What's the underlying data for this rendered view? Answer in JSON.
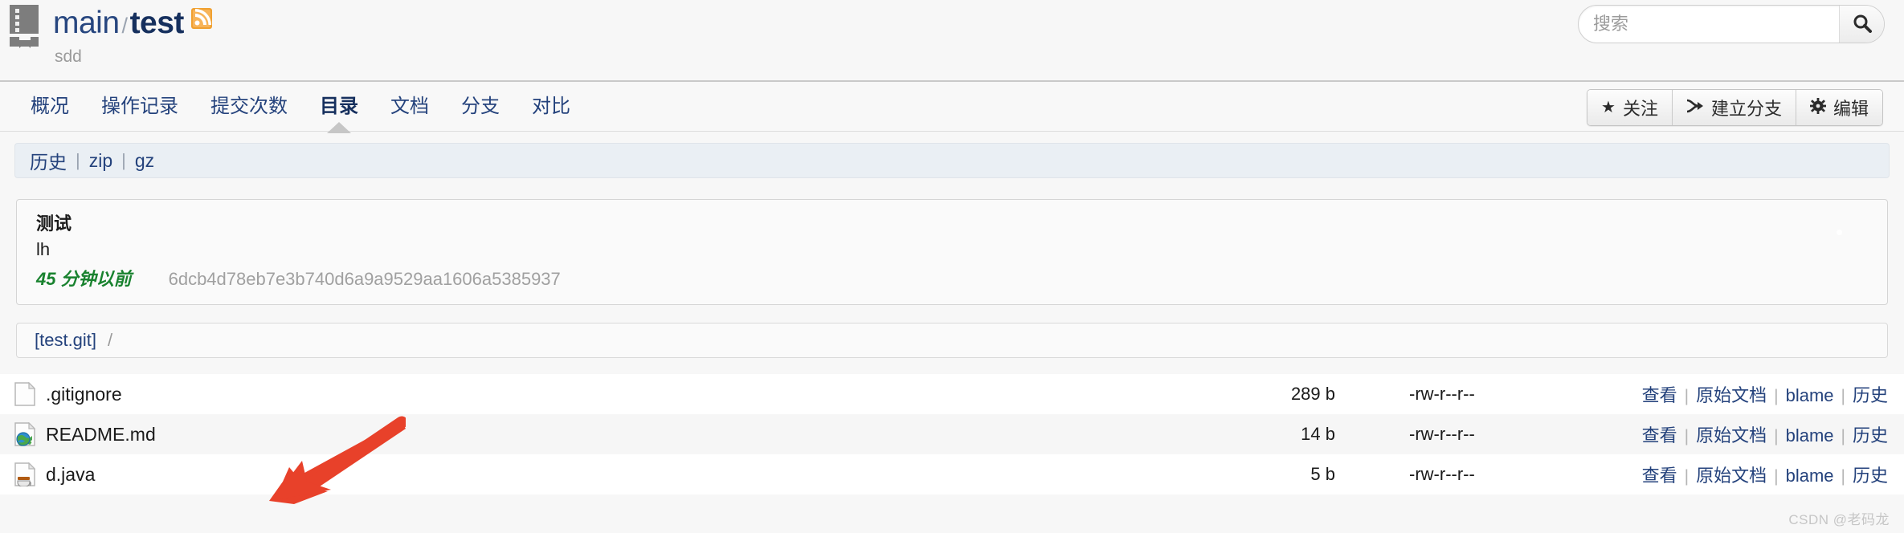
{
  "header": {
    "repo_icon": "book-icon",
    "owner": "main",
    "separator": "/",
    "repo_name": "test",
    "rss_icon": "rss-icon",
    "description": "sdd"
  },
  "search": {
    "placeholder": "搜索",
    "value": "",
    "icon": "search-icon"
  },
  "nav": {
    "tabs": [
      {
        "label": "概况",
        "active": false
      },
      {
        "label": "操作记录",
        "active": false
      },
      {
        "label": "提交次数",
        "active": false
      },
      {
        "label": "目录",
        "active": true
      },
      {
        "label": "文档",
        "active": false
      },
      {
        "label": "分支",
        "active": false
      },
      {
        "label": "对比",
        "active": false
      }
    ],
    "actions": [
      {
        "icon": "star-icon",
        "glyph": "★",
        "label": "关注"
      },
      {
        "icon": "branch-icon",
        "glyph": "⑂",
        "label": "建立分支"
      },
      {
        "icon": "gear-icon",
        "glyph": "✿",
        "label": "编辑"
      }
    ]
  },
  "subbar": {
    "links": [
      "历史",
      "zip",
      "gz"
    ],
    "pipe": "|"
  },
  "commit": {
    "subject": "测试",
    "author": "lh",
    "age": "45 分钟以前",
    "hash": "6dcb4d78eb7e3b740d6a9a9529aa1606a5385937"
  },
  "breadcrumb": {
    "root": "[test.git]",
    "slash": "/"
  },
  "files": {
    "action_pipe": "|",
    "rows": [
      {
        "icon": "file-plain-icon",
        "name": ".gitignore",
        "size": "289 b",
        "permissions": "-rw-r--r--",
        "actions": [
          "查看",
          "原始文档",
          "blame",
          "历史"
        ]
      },
      {
        "icon": "file-html-icon",
        "name": "README.md",
        "size": "14 b",
        "permissions": "-rw-r--r--",
        "actions": [
          "查看",
          "原始文档",
          "blame",
          "历史"
        ]
      },
      {
        "icon": "file-java-icon",
        "name": "d.java",
        "size": "5 b",
        "permissions": "-rw-r--r--",
        "actions": [
          "查看",
          "原始文档",
          "blame",
          "历史"
        ]
      }
    ]
  },
  "annotation": {
    "arrow_icon": "red-arrow-icon",
    "arrow_color": "#e8412a"
  },
  "watermark": "CSDN @老码龙",
  "colors": {
    "page_bg": "#f7f7f7",
    "link": "#24427c",
    "title": "#16305e",
    "green": "#19822f",
    "muted": "#9b9b9b",
    "subbar_bg": "#eaeff4",
    "arrow_red": "#e8412a"
  }
}
